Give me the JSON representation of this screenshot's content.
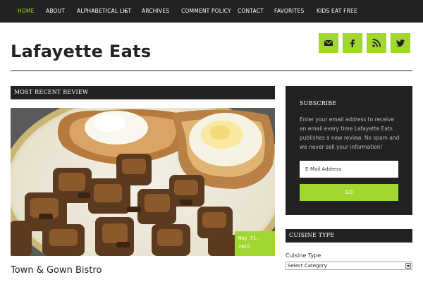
{
  "nav": {
    "items": [
      {
        "label": "HOME",
        "active": true
      },
      {
        "label": "ABOUT",
        "active": false
      },
      {
        "label": "ALPHABETICAL LIST",
        "active": false
      },
      {
        "label": "ARCHIVES",
        "active": false
      },
      {
        "label": "COMMENT POLICY",
        "active": false
      },
      {
        "label": "CONTACT",
        "active": false
      },
      {
        "label": "FAVORITES",
        "active": false
      },
      {
        "label": "KIDS EAT FREE",
        "active": false
      }
    ]
  },
  "header": {
    "title": "Lafayette Eats",
    "social": [
      "mail-icon",
      "facebook-icon",
      "rss-icon",
      "twitter-icon"
    ]
  },
  "main": {
    "section_title": "MOST RECENT REVIEW",
    "post": {
      "date_line1": "May 31,",
      "date_line2": "2015",
      "title": "Town & Gown Bistro"
    }
  },
  "sidebar": {
    "subscribe": {
      "title": "SUBSCRIBE",
      "text": "Enter your email address to receive an email every time Lafayette Eats publishes a new review. No spam and we never sell your information!",
      "email_placeholder": "E-Mail Address",
      "button_label": "GO"
    },
    "cuisine": {
      "title": "CUISINE TYPE",
      "label": "Cuisine Type",
      "selected": "Select Category"
    }
  },
  "colors": {
    "accent": "#a2d630",
    "dark": "#222222"
  }
}
